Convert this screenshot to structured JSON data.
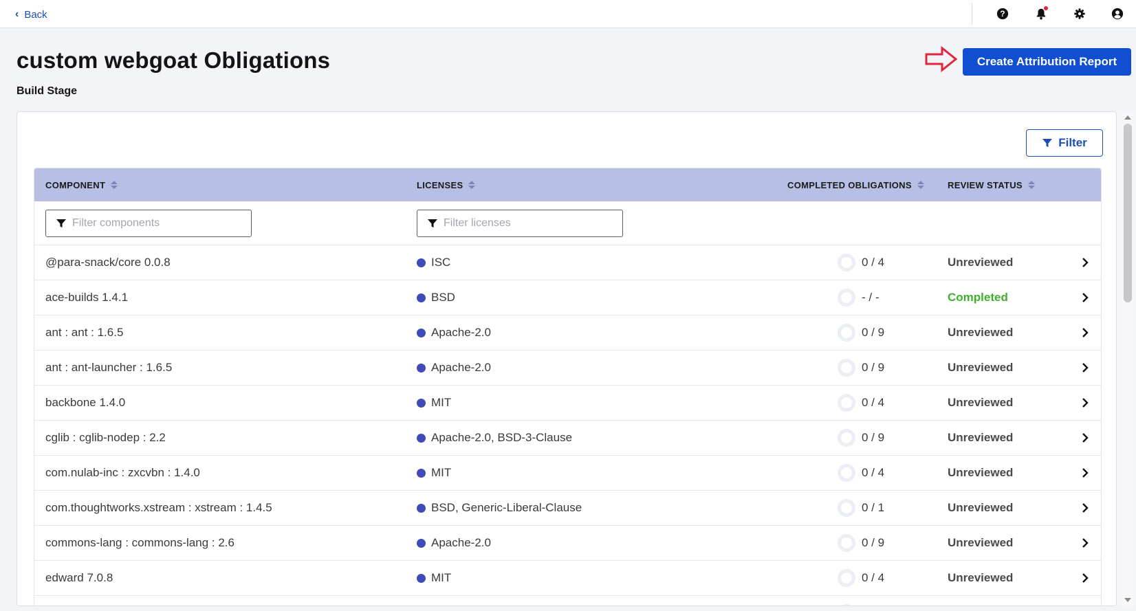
{
  "topbar": {
    "back_label": "Back",
    "icons": [
      "help-icon",
      "bell-icon",
      "gear-icon",
      "user-icon"
    ]
  },
  "header": {
    "title": "custom webgoat Obligations",
    "subtitle": "Build Stage",
    "primary_button": "Create Attribution Report"
  },
  "toolbar": {
    "filter_label": "Filter"
  },
  "table": {
    "columns": {
      "component": "COMPONENT",
      "licenses": "LICENSES",
      "completed": "COMPLETED OBLIGATIONS",
      "review": "REVIEW STATUS"
    },
    "filters": {
      "component_placeholder": "Filter components",
      "license_placeholder": "Filter licenses"
    },
    "rows": [
      {
        "component": "@para-snack/core 0.0.8",
        "licenses": "ISC",
        "completed": "0 / 4",
        "status": "Unreviewed"
      },
      {
        "component": "ace-builds 1.4.1",
        "licenses": "BSD",
        "completed": "- / -",
        "status": "Completed"
      },
      {
        "component": "ant : ant : 1.6.5",
        "licenses": "Apache-2.0",
        "completed": "0 / 9",
        "status": "Unreviewed"
      },
      {
        "component": "ant : ant-launcher : 1.6.5",
        "licenses": "Apache-2.0",
        "completed": "0 / 9",
        "status": "Unreviewed"
      },
      {
        "component": "backbone 1.4.0",
        "licenses": "MIT",
        "completed": "0 / 4",
        "status": "Unreviewed"
      },
      {
        "component": "cglib : cglib-nodep : 2.2",
        "licenses": "Apache-2.0, BSD-3-Clause",
        "completed": "0 / 9",
        "status": "Unreviewed"
      },
      {
        "component": "com.nulab-inc : zxcvbn : 1.4.0",
        "licenses": "MIT",
        "completed": "0 / 4",
        "status": "Unreviewed"
      },
      {
        "component": "com.thoughtworks.xstream : xstream : 1.4.5",
        "licenses": "BSD, Generic-Liberal-Clause",
        "completed": "0 / 1",
        "status": "Unreviewed"
      },
      {
        "component": "commons-lang : commons-lang : 2.6",
        "licenses": "Apache-2.0",
        "completed": "0 / 9",
        "status": "Unreviewed"
      },
      {
        "component": "edward 7.0.8",
        "licenses": "MIT",
        "completed": "0 / 4",
        "status": "Unreviewed"
      }
    ]
  },
  "colors": {
    "primary": "#0f4fd0",
    "header_bg": "#b7bfe4",
    "license_dot": "#3e4bb8",
    "completed_status": "#3fb02b",
    "annotation_arrow": "#e0263b"
  }
}
